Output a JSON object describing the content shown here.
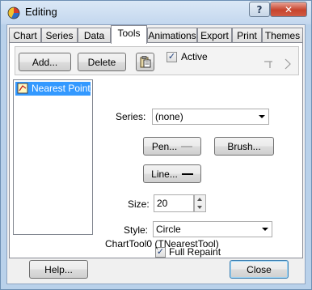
{
  "window": {
    "title": "Editing",
    "help_glyph": "?",
    "close_glyph": "✕"
  },
  "tabs": [
    "Chart",
    "Series",
    "Data",
    "Tools",
    "Animations",
    "Export",
    "Print",
    "Themes"
  ],
  "active_tab": "Tools",
  "toolbar": {
    "add_label": "Add...",
    "delete_label": "Delete",
    "active_label": "Active",
    "active_checked": true
  },
  "tool_list": {
    "items": [
      "Nearest Point"
    ],
    "selected": "Nearest Point"
  },
  "properties": {
    "series_label": "Series:",
    "series_value": "(none)",
    "pen_label": "Pen...",
    "brush_label": "Brush...",
    "line_label": "Line...",
    "size_label": "Size:",
    "size_value": "20",
    "style_label": "Style:",
    "style_value": "Circle",
    "full_repaint_label": "Full Repaint",
    "full_repaint_checked": true,
    "tool_status": "ChartTool0 (TNearestTool)"
  },
  "footer": {
    "help_label": "Help...",
    "close_label": "Close"
  }
}
